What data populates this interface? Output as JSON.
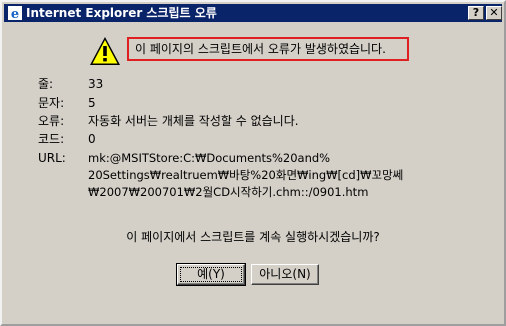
{
  "titlebar": {
    "title": "Internet Explorer 스크립트 오류",
    "help_label": "?",
    "close_label": "✕"
  },
  "message": "이 페이지의 스크립트에서 오류가 발생하였습니다.",
  "details": {
    "line_label": "줄:",
    "line_value": "33",
    "char_label": "문자:",
    "char_value": "5",
    "error_label": "오류:",
    "error_value": "자동화 서버는 개체를 작성할 수 없습니다.",
    "code_label": "코드:",
    "code_value": "0",
    "url_label": "URL:",
    "url_lines": [
      "mk:@MSITStore:C:₩Documents%20and%",
      "20Settings₩realtruem₩바탕%20화면₩ing₩[cd]₩꼬망쎄",
      "₩2007₩200701₩2월CD시작하기.chm::/0901.htm"
    ]
  },
  "question": "이 페이지에서 스크립트를 계속 실행하시겠습니까?",
  "buttons": {
    "yes_label": "예(Y)",
    "no_label": "아니오(N)"
  },
  "icons": {
    "title_icon": "ie-icon",
    "warning_icon": "warning-icon"
  }
}
